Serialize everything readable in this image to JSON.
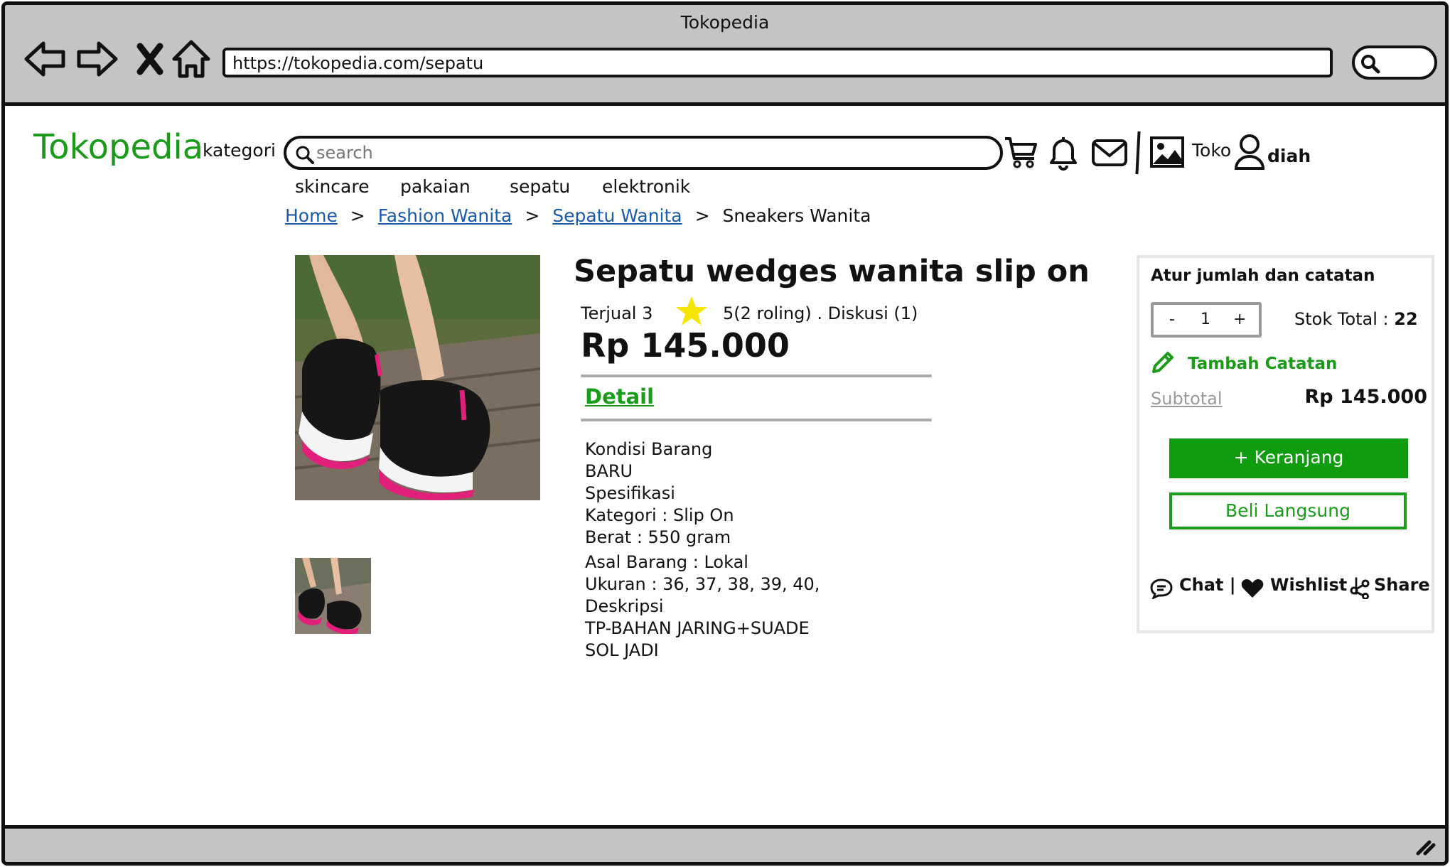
{
  "window": {
    "title": "Tokopedia"
  },
  "browser": {
    "url": "https://tokopedia.com/sepatu"
  },
  "header": {
    "logo": "Tokopedia",
    "kategori": "kategori",
    "search_placeholder": "search",
    "toko": "Toko",
    "user": "diah",
    "categories": [
      "skincare",
      "pakaian",
      "sepatu",
      "elektronik"
    ]
  },
  "breadcrumb": {
    "items": [
      "Home",
      "Fashion Wanita",
      "Sepatu Wanita"
    ],
    "current": "Sneakers Wanita"
  },
  "product": {
    "title": "Sepatu wedges wanita slip on",
    "sold": "Terjual 3",
    "rating": "5(2 roling) . Diskusi (1)",
    "price": "Rp 145.000",
    "detail_tab": "Detail",
    "specs": [
      "Kondisi Barang",
      "BARU",
      "Spesifikasi",
      "Kategori : Slip On",
      "Berat : 550 gram",
      "Asal Barang : Lokal",
      "Ukuran : 36, 37, 38, 39, 40,",
      "Deskripsi",
      "TP-BAHAN JARING+SUADE",
      "SOL JADI"
    ]
  },
  "panel": {
    "title": "Atur jumlah dan catatan",
    "minus": "-",
    "qty": "1",
    "plus": "+",
    "stock_label": "Stok Total : ",
    "stock_value": "22",
    "note": "Tambah Catatan",
    "subtotal_label": "Subtotal",
    "subtotal_value": "Rp 145.000",
    "cart_button": "+ Keranjang",
    "buy_button": "Beli Langsung",
    "chat": "Chat |",
    "wishlist": "Wishlist |",
    "share": "Share"
  },
  "colors": {
    "brand_green": "#1a9c1a",
    "button_green": "#0f9d0f",
    "link_blue": "#1a5aa8",
    "star": "#f5e600"
  },
  "icons": [
    "back-arrow-icon",
    "forward-arrow-icon",
    "close-icon",
    "home-icon",
    "search-icon",
    "cart-icon",
    "bell-icon",
    "mail-icon",
    "image-icon",
    "user-icon",
    "pencil-icon",
    "chat-icon",
    "heart-icon",
    "share-icon",
    "star-icon",
    "resize-icon"
  ]
}
